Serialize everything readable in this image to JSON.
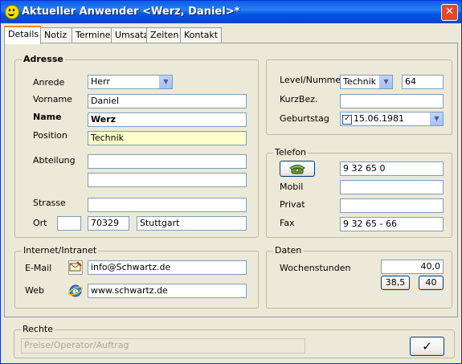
{
  "window": {
    "title": "Aktueller Anwender <Werz, Daniel>*",
    "close": "✕"
  },
  "tabs": [
    "Details",
    "Notiz",
    "Termine",
    "Umsatz",
    "Zeiten",
    "Kontakt"
  ],
  "adresse": {
    "legend": "Adresse",
    "anrede_label": "Anrede",
    "anrede_value": "Herr",
    "vorname_label": "Vorname",
    "vorname_value": "Daniel",
    "name_label": "Name",
    "name_value": "Werz",
    "position_label": "Position",
    "position_value": "Technik",
    "abteilung_label": "Abteilung",
    "abteilung_value1": "",
    "abteilung_value2": "",
    "strasse_label": "Strasse",
    "strasse_value": "",
    "ort_label": "Ort",
    "ort_country": "",
    "ort_plz": "70329",
    "ort_city": "Stuttgart"
  },
  "level": {
    "level_label": "Level/Nummer",
    "level_value": "Technik",
    "nummer_value": "64",
    "kurzbez_label": "KurzBez.",
    "kurzbez_value": "",
    "geburtstag_label": "Geburtstag",
    "geburtstag_value": "15.06.1981",
    "geburtstag_checked": "✓"
  },
  "telefon": {
    "legend": "Telefon",
    "phone_value": "9 32 65 0",
    "mobil_label": "Mobil",
    "mobil_value": "",
    "privat_label": "Privat",
    "privat_value": "",
    "fax_label": "Fax",
    "fax_value": "9 32 65 - 66"
  },
  "internet": {
    "legend": "Internet/Intranet",
    "email_label": "E-Mail",
    "email_value": "info@Schwartz.de",
    "web_label": "Web",
    "web_value": "www.schwartz.de"
  },
  "daten": {
    "legend": "Daten",
    "wochenstunden_label": "Wochenstunden",
    "wochenstunden_value": "40,0",
    "preset1": "38,5",
    "preset2": "40"
  },
  "rechte": {
    "legend": "Rechte",
    "value": "Preise/Operator/Auftrag"
  },
  "ok_button": "✓",
  "icons": {
    "title": "smiley-icon",
    "phone": "telephone-icon",
    "email": "email-icon",
    "web": "internet-explorer-icon"
  }
}
